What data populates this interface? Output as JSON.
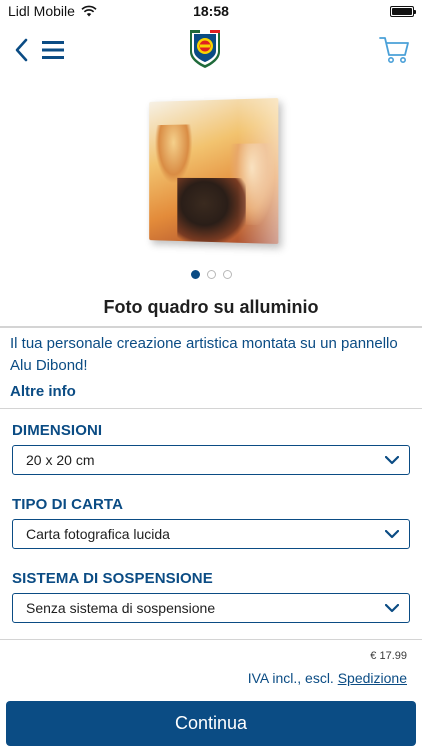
{
  "status_bar": {
    "carrier": "Lidl Mobile",
    "time": "18:58"
  },
  "nav": {
    "icons": [
      "chevron-left-icon",
      "hamburger-menu-icon",
      "lidl-shield-logo",
      "cart-icon"
    ]
  },
  "carousel": {
    "page_count": 3,
    "active_index": 0
  },
  "product": {
    "title": "Foto quadro su alluminio",
    "description": "Il tua personale creazione artistica montata su un pannello Alu Dibond!",
    "more_info_label": "Altre info"
  },
  "options": {
    "dimensions": {
      "label": "DIMENSIONI",
      "value": "20 x 20 cm"
    },
    "paper_type": {
      "label": "TIPO DI CARTA",
      "value": "Carta fotografica lucida"
    },
    "suspension": {
      "label": "SISTEMA DI SOSPENSIONE",
      "value": "Senza sistema di sospensione"
    }
  },
  "pricing": {
    "price": "€ 17.99",
    "vat_prefix": "IVA incl., escl.",
    "shipping_link": "Spedizione"
  },
  "actions": {
    "continue_label": "Continua"
  },
  "colors": {
    "brand_blue": "#0b4c84",
    "divider": "#d4d4d4"
  }
}
